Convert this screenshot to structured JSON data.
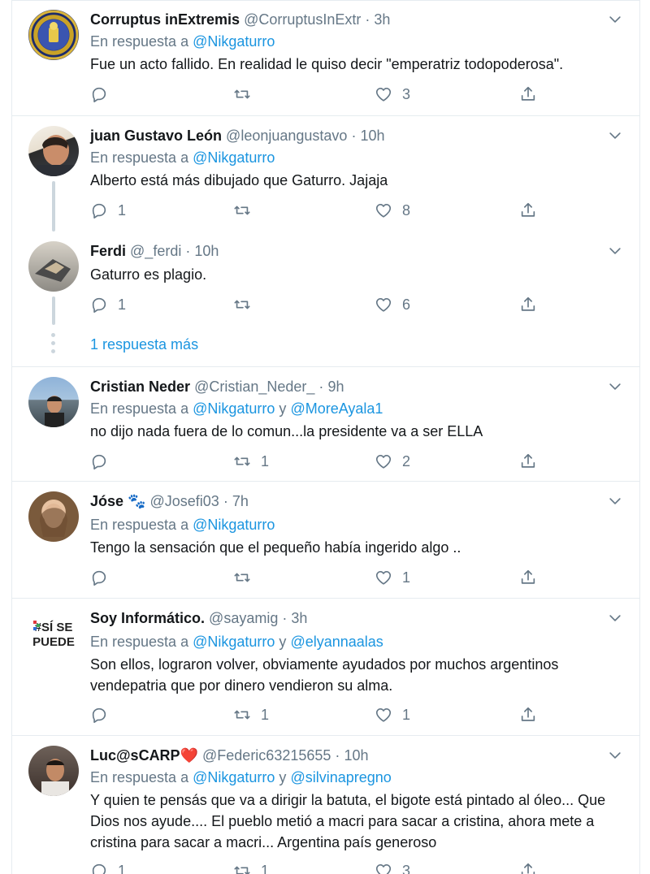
{
  "reply_prefix": "En respuesta a",
  "and_word": "y",
  "icons": {
    "reply": "reply-icon",
    "retweet": "retweet-icon",
    "like": "like-icon",
    "share": "share-icon",
    "caret": "chevron-down-icon"
  },
  "colors": {
    "link": "#1b95e0",
    "muted": "#657786",
    "heart": "#e0245e"
  },
  "tweets": [
    {
      "name": "Corruptus inExtremis",
      "handle": "@CorruptusInExtr",
      "time": "3h",
      "mentions": [
        "@Nikgaturro"
      ],
      "text": "Fue un acto fallido. En realidad le quiso decir \"emperatriz todopoderosa\".",
      "replies": "",
      "retweets": "",
      "likes": "3"
    },
    {
      "name": "juan Gustavo León",
      "handle": "@leonjuangustavo",
      "time": "10h",
      "mentions": [
        "@Nikgaturro"
      ],
      "text": "Alberto está más dibujado que Gaturro. Jajaja",
      "replies": "1",
      "retweets": "",
      "likes": "8"
    },
    {
      "name": "Ferdi",
      "handle": "@_ferdi",
      "time": "10h",
      "mentions": [],
      "text": "Gaturro es plagio.",
      "replies": "1",
      "retweets": "",
      "likes": "6"
    },
    {
      "name": "Cristian Neder",
      "handle": "@Cristian_Neder_",
      "time": "9h",
      "mentions": [
        "@Nikgaturro",
        "@MoreAyala1"
      ],
      "text": "no dijo nada fuera de lo comun...la presidente va a ser ELLA",
      "replies": "",
      "retweets": "1",
      "likes": "2"
    },
    {
      "name": "Jóse",
      "name_emoji": "🐾",
      "handle": "@Josefi03",
      "time": "7h",
      "mentions": [
        "@Nikgaturro"
      ],
      "text": "Tengo la sensación que el pequeño había ingerido algo ..",
      "replies": "",
      "retweets": "",
      "likes": "1"
    },
    {
      "name": "Soy Informático.",
      "handle": "@sayamig",
      "time": "3h",
      "mentions": [
        "@Nikgaturro",
        "@elyannaalas"
      ],
      "text": "Son ellos, lograron volver, obviamente ayudados por muchos argentinos vendepatria que por dinero vendieron su alma.",
      "replies": "",
      "retweets": "1",
      "likes": "1"
    },
    {
      "name": "Luc@sCARP",
      "name_emoji": "❤️",
      "handle": "@Federic63215655",
      "time": "10h",
      "mentions": [
        "@Nikgaturro",
        "@silvinapregno"
      ],
      "text": "Y quien te pensás que va a dirigir la batuta, el bigote está pintado al óleo... Que Dios nos ayude.... El pueblo metió a macri para sacar a cristina, ahora mete a cristina para sacar a macri... Argentina país generoso",
      "replies": "1",
      "retweets": "1",
      "likes": "3"
    }
  ],
  "more_replies": "1 respuesta más",
  "avatar4_text": {
    "line1": "#SÍ SE",
    "line2": "PUEDE"
  }
}
